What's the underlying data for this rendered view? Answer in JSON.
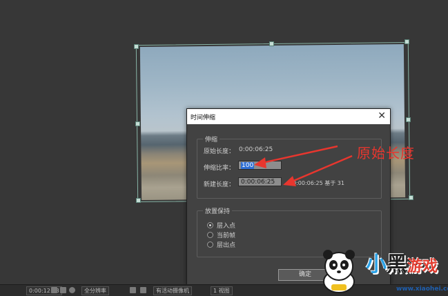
{
  "dialog": {
    "title": "时间伸缩",
    "close_glyph": "✕",
    "stretch_group": {
      "label": "伸缩",
      "original_duration_label": "原始长度：",
      "original_duration_value": "0:00:06:25",
      "stretch_factor_label": "伸缩比率：",
      "stretch_factor_value": "100",
      "new_duration_label": "新建长度：",
      "new_duration_value": "0:00:06:25",
      "new_duration_hint": "0:00:06:25  基于 31"
    },
    "hold_group": {
      "label": "放置保持",
      "options": [
        {
          "label": "层入点",
          "selected": true
        },
        {
          "label": "当前帧",
          "selected": false
        },
        {
          "label": "层出点",
          "selected": false
        }
      ]
    },
    "ok_button": "确定"
  },
  "annotation": {
    "text": "原始长度",
    "color": "#e8362e"
  },
  "toolbar": {
    "timecode": "0:00:12:08",
    "resolution": "全分辨率",
    "renderer": "有活动摄像机",
    "views": "1 视图"
  },
  "watermark": {
    "text_part1": "小",
    "text_part2": "黑",
    "text_part3": "游戏",
    "url": "www.xiaohei.com"
  },
  "icons": {
    "close": "close-icon",
    "camera": "camera-icon",
    "person": "person-icon",
    "color": "color-wheel-icon",
    "grid": "grid-icon"
  }
}
